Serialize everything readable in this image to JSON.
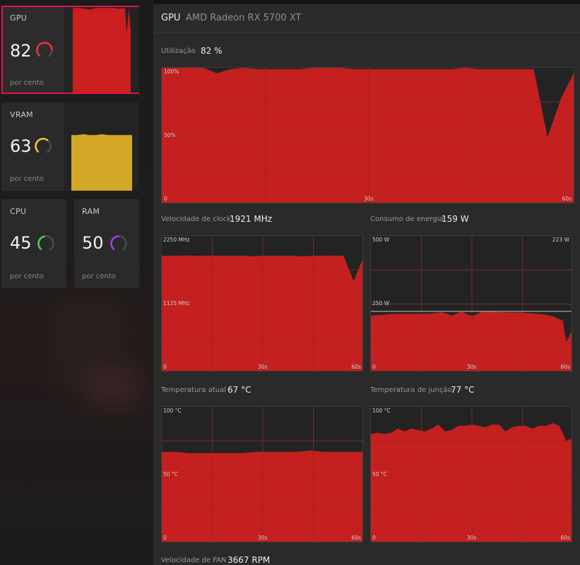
{
  "sidebar": {
    "gpu": {
      "label": "GPU",
      "value": "82",
      "unit": "por cento",
      "color": "#e8343a",
      "level": 82
    },
    "vram": {
      "label": "VRAM",
      "value": "63",
      "unit": "por cento",
      "color": "#f2c230",
      "level": 63
    },
    "cpu": {
      "label": "CPU",
      "value": "45",
      "unit": "por cento",
      "color": "#4ecb4e",
      "level": 45
    },
    "ram": {
      "label": "RAM",
      "value": "50",
      "unit": "por cento",
      "color": "#9b3cf0",
      "level": 50
    }
  },
  "header": {
    "title": "GPU",
    "device": "AMD Radeon RX 5700 XT"
  },
  "accent_color": "#c42020",
  "vram_fill_color": "#d4a827",
  "metrics": {
    "util": {
      "label": "Utilização",
      "value": "82 %",
      "y_top": "100%",
      "y_mid": "50%",
      "y_zero": "0",
      "x_mid": "30s",
      "x_end": "60s"
    },
    "clock": {
      "label": "Velocidade de clock",
      "value": "1921 MHz",
      "y_top": "2250 MHz",
      "y_mid": "1125 MHz",
      "y_zero": "0",
      "x_mid": "30s",
      "x_end": "60s"
    },
    "power": {
      "label": "Consumo de energia",
      "value": "159 W",
      "y_top": "500 W",
      "y_top_right": "223 W",
      "y_mid": "250 W",
      "y_zero": "0",
      "x_mid": "30s",
      "x_end": "60s"
    },
    "temp": {
      "label": "Temperatura atual",
      "value": "67 °C",
      "y_top": "100 °C",
      "y_mid": "50 °C",
      "y_zero": "0",
      "x_mid": "30s",
      "x_end": "60s"
    },
    "junction": {
      "label": "Temperatura de junção",
      "value": "77 °C",
      "y_top": "100 °C",
      "y_mid": "50 °C",
      "y_zero": "0",
      "x_mid": "30s",
      "x_end": "60s"
    },
    "fan": {
      "label": "Velocidade de FAN",
      "value": "3667 RPM"
    }
  },
  "chart_data": [
    {
      "type": "area",
      "name": "Utilização",
      "ylim": [
        0,
        100
      ],
      "xlim": [
        0,
        60
      ],
      "x": [
        0,
        2,
        4,
        6,
        8,
        10,
        12,
        14,
        16,
        18,
        20,
        22,
        24,
        26,
        28,
        30,
        32,
        34,
        36,
        38,
        40,
        42,
        44,
        46,
        48,
        50,
        52,
        54,
        56,
        58,
        60
      ],
      "values": [
        100,
        100,
        100,
        100,
        96,
        99,
        100,
        99,
        99,
        99,
        99,
        100,
        100,
        100,
        99,
        99,
        99,
        99,
        99,
        99,
        99,
        99,
        100,
        99,
        99,
        99,
        99,
        99,
        49,
        78,
        98
      ]
    },
    {
      "type": "area",
      "name": "Velocidade de clock",
      "ylim": [
        0,
        2250
      ],
      "xlim": [
        0,
        60
      ],
      "x": [
        0,
        3,
        6,
        9,
        12,
        15,
        18,
        21,
        24,
        27,
        30,
        33,
        36,
        39,
        42,
        45,
        48,
        51,
        54,
        57,
        60
      ],
      "values": [
        1920,
        1920,
        1925,
        1925,
        1920,
        1925,
        1920,
        1920,
        1920,
        1915,
        1920,
        1920,
        1920,
        1920,
        1915,
        1920,
        1920,
        1925,
        1920,
        1500,
        1921
      ]
    },
    {
      "type": "area",
      "name": "Consumo de energia",
      "ylim": [
        0,
        500
      ],
      "xlim": [
        0,
        60
      ],
      "x": [
        0,
        3,
        6,
        9,
        12,
        15,
        18,
        21,
        24,
        27,
        30,
        33,
        36,
        39,
        42,
        45,
        48,
        51,
        54,
        57,
        58,
        60
      ],
      "values": [
        208,
        210,
        213,
        214,
        214,
        214,
        215,
        220,
        208,
        222,
        205,
        222,
        222,
        220,
        219,
        219,
        215,
        213,
        205,
        190,
        110,
        159
      ]
    },
    {
      "type": "area",
      "name": "Temperatura atual",
      "ylim": [
        0,
        100
      ],
      "xlim": [
        0,
        60
      ],
      "x": [
        0,
        4,
        8,
        12,
        16,
        20,
        24,
        28,
        32,
        36,
        40,
        44,
        48,
        52,
        56,
        58,
        60
      ],
      "values": [
        67,
        67,
        66,
        66,
        66,
        66,
        66,
        67,
        67,
        67,
        67,
        68,
        67,
        67,
        67,
        67,
        67
      ]
    },
    {
      "type": "area",
      "name": "Temperatura de junção",
      "ylim": [
        0,
        100
      ],
      "xlim": [
        0,
        60
      ],
      "x": [
        0,
        2,
        4,
        6,
        8,
        10,
        12,
        14,
        16,
        18,
        20,
        22,
        24,
        26,
        28,
        30,
        32,
        34,
        36,
        38,
        40,
        42,
        44,
        46,
        48,
        50,
        52,
        54,
        56,
        58,
        60
      ],
      "values": [
        80,
        81,
        80,
        81,
        84,
        82,
        84,
        83,
        82,
        84,
        87,
        82,
        83,
        86,
        86,
        87,
        86,
        85,
        87,
        87,
        82,
        85,
        86,
        86,
        84,
        86,
        86,
        88,
        86,
        75,
        77
      ]
    },
    {
      "type": "area",
      "name": "GPU sparkline",
      "ylim": [
        0,
        100
      ],
      "xlim": [
        0,
        60
      ],
      "x": [
        0,
        6,
        12,
        18,
        24,
        30,
        36,
        42,
        48,
        54,
        56,
        58,
        60
      ],
      "values": [
        99,
        99,
        98,
        97,
        99,
        99,
        99,
        99,
        98,
        99,
        70,
        99,
        72
      ]
    },
    {
      "type": "area",
      "name": "VRAM sparkline",
      "ylim": [
        0,
        100
      ],
      "xlim": [
        0,
        60
      ],
      "x": [
        0,
        6,
        12,
        18,
        24,
        30,
        36,
        42,
        48,
        54,
        60
      ],
      "values": [
        63,
        63,
        64,
        63,
        63,
        64,
        63,
        63,
        63,
        63,
        63
      ]
    }
  ]
}
